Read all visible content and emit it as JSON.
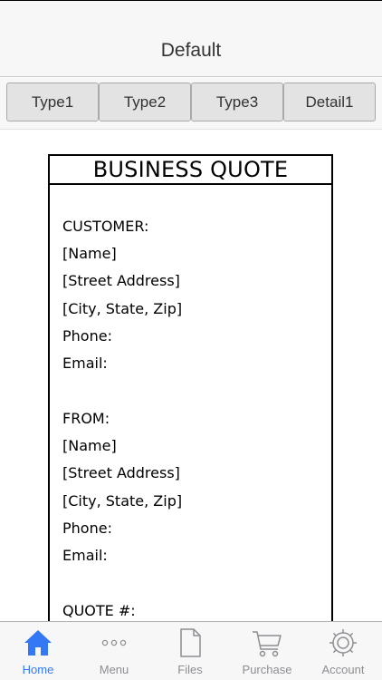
{
  "nav": {
    "title": "Default"
  },
  "segments": [
    {
      "label": "Type1"
    },
    {
      "label": "Type2"
    },
    {
      "label": "Type3"
    },
    {
      "label": "Detail1"
    }
  ],
  "document": {
    "title": "BUSINESS QUOTE",
    "lines": [
      "CUSTOMER:",
      "[Name]",
      "[Street Address]",
      "[City, State, Zip]",
      "Phone:",
      "Email:",
      "FROM:",
      "[Name]",
      "[Street Address]",
      "[City, State, Zip]",
      "Phone:",
      "Email:",
      "QUOTE #:"
    ]
  },
  "tabbar": {
    "active": "Home",
    "items": [
      {
        "label": "Home",
        "icon": "home-icon"
      },
      {
        "label": "Menu",
        "icon": "more-icon"
      },
      {
        "label": "Files",
        "icon": "file-icon"
      },
      {
        "label": "Purchase",
        "icon": "cart-icon"
      },
      {
        "label": "Account",
        "icon": "gear-icon"
      }
    ]
  },
  "colors": {
    "accent": "#3478f6",
    "inactive": "#8e8e93",
    "bar_bg": "#f7f7f7"
  }
}
